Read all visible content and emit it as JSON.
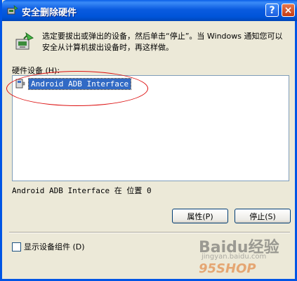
{
  "window": {
    "title": "安全删除硬件",
    "help_label": "?",
    "close_label": "×"
  },
  "description": "选定要拔出或弹出的设备，然后单击“停止”。当 Windows 通知您可以安全从计算机拔出设备时，再这样做。",
  "hardware_list": {
    "label": "硬件设备 (H):",
    "items": [
      {
        "name": "Android ADB Interface",
        "selected": true
      }
    ]
  },
  "location_text": "Android ADB Interface 在 位置 0",
  "buttons": {
    "properties": "属性(P)",
    "stop": "停止(S)"
  },
  "show_components": {
    "label": "显示设备组件 (D)",
    "checked": false
  },
  "watermark": {
    "line1": "Baidu经验",
    "line2": "jingyan.baidu.com",
    "line3": "95SHOP"
  },
  "colors": {
    "titlebar": "#0054d8",
    "selection": "#316ac5",
    "annotation": "#dd1111"
  }
}
